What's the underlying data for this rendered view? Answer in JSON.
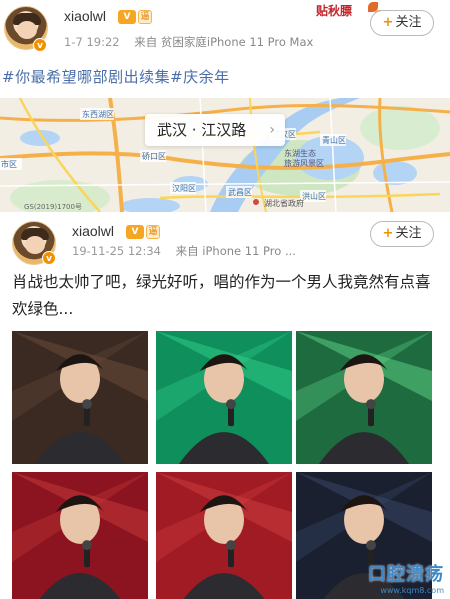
{
  "post1": {
    "username": "xiaolwl",
    "level_badge": "V",
    "vip_badge": "逼",
    "time": "1-7 19:22",
    "source_prefix": "来自",
    "source": "贫困家庭iPhone 11 Pro Max",
    "follow_label": "关注",
    "follow_icon": "plus-icon",
    "sticker_text": "贴秋膘",
    "topics": "#你最希望哪部剧出续集#庆余年",
    "map": {
      "location": "武汉 · 江汉路",
      "credit": "GS(2019)1700号",
      "labels": [
        "东西湖区",
        "硚口区",
        "汉阳区",
        "江汉区",
        "武昌区",
        "洪山区",
        "青山区",
        "武汉市",
        "东湖生态旅游风景区",
        "湖北省政府"
      ]
    }
  },
  "post2": {
    "username": "xiaolwl",
    "level_badge": "V",
    "vip_badge": "逼",
    "time": "19-11-25 12:34",
    "source_prefix": "来自",
    "source": "iPhone 11 Pro ...",
    "follow_label": "关注",
    "follow_icon": "plus-icon",
    "text": "肖战也太帅了吧，绿光好听，唱的作为一个男人我竟然有点喜欢绿色...",
    "photos": [
      {
        "bg": "#3a2a22",
        "accent": "#6b4b3a"
      },
      {
        "bg": "#0f8f5c",
        "accent": "#34d18c"
      },
      {
        "bg": "#1e6b3f",
        "accent": "#5fd68a"
      },
      {
        "bg": "#8c1420",
        "accent": "#c83a3a"
      },
      {
        "bg": "#a11b24",
        "accent": "#d04040"
      },
      {
        "bg": "#1a2030",
        "accent": "#3a4a6a"
      }
    ]
  },
  "watermark": {
    "main": "口腔溃疡",
    "sub": "www.kqm8.com"
  },
  "colors": {
    "topic": "#4a6fa8",
    "follow_plus": "#f29100",
    "badge": "#f6a623"
  }
}
